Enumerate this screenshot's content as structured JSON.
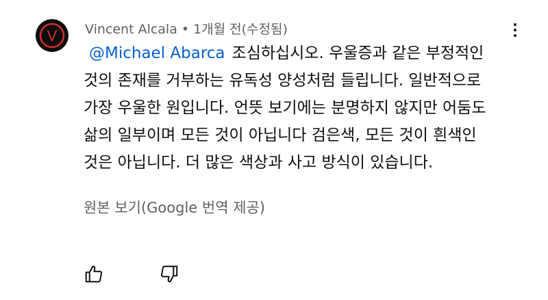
{
  "comment": {
    "avatar_letter": "V",
    "author": "Vincent Alcala",
    "separator": "•",
    "time": "1개월 전(수정됨)",
    "mention": "@Michael Abarca",
    "lines": [
      "조심하십시오. 우울증과 같은 부정적인",
      "것의 존재를 거부하는 유독성 양성처럼 들립니다. 일반적으로",
      "가장 우울한 원입니다. 언뜻 보기에는 분명하지 않지만 어둠도",
      "삶의 일부이며 모든 것이 아닙니다 검은색, 모든 것이 흰색인",
      "것은 아닙니다. 더 많은 색상과 사고 방식이 있습니다."
    ],
    "translate_label": "원본 보기(Google 번역 제공)"
  },
  "colors": {
    "text": "#0f0f0f",
    "secondary": "#606060",
    "mention": "#065fd4",
    "avatar_bg": "#0d0d0d",
    "avatar_ring": "#d32f2f"
  },
  "icons": {
    "more": "more-vert-icon",
    "like": "thumb-up-icon",
    "dislike": "thumb-down-icon"
  }
}
